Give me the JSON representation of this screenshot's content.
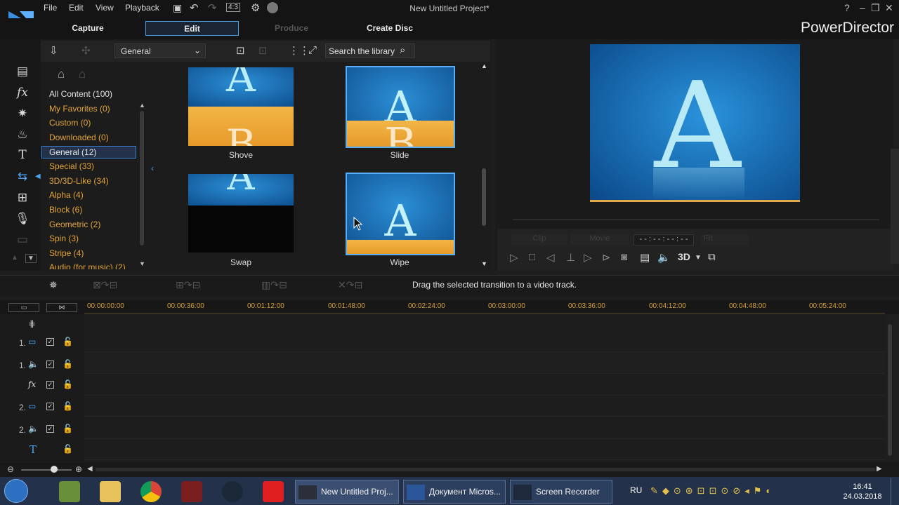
{
  "window": {
    "title": "New Untitled Project*",
    "brand": "PowerDirector"
  },
  "menu": [
    "File",
    "Edit",
    "View",
    "Playback"
  ],
  "modes": [
    "Capture",
    "Edit",
    "Produce",
    "Create Disc"
  ],
  "library": {
    "category_selected": "General",
    "search_placeholder": "Search the library",
    "categories": [
      "All Content (100)",
      "My Favorites  (0)",
      "Custom  (0)",
      "Downloaded  (0)",
      "General  (12)",
      "Special  (33)",
      "3D/3D-Like  (34)",
      "Alpha  (4)",
      "Block  (6)",
      "Geometric  (2)",
      "Spin  (3)",
      "Stripe  (4)",
      "Audio (for music)  (2)"
    ],
    "transitions": [
      "Shove",
      "Slide",
      "Swap",
      "Wipe"
    ]
  },
  "preview": {
    "mode_clip": "Clip",
    "mode_movie": "Movie",
    "timecode": "- - : - - : - - : - -",
    "fit": "Fit",
    "stereo": "3D"
  },
  "hint": "Drag the selected transition to a video track.",
  "ruler": [
    "00:00:00:00",
    "00:00:36:00",
    "00:01:12:00",
    "00:01:48:00",
    "00:02:24:00",
    "00:03:00:00",
    "00:03:36:00",
    "00:04:12:00",
    "00:04:48:00",
    "00:05:24:00"
  ],
  "tracks": [
    "1.",
    "1.",
    "",
    "2.",
    "2.",
    ""
  ],
  "taskbar": {
    "apps": [
      "New Untitled Proj...",
      "Документ Micros...",
      "Screen Recorder"
    ],
    "lang": "RU",
    "time": "16:41",
    "date": "24.03.2018"
  },
  "colors": {
    "accent": "#4e9fe6",
    "category": "#e3a53a",
    "ruler": "#d6a13b",
    "taskbar": "#23324a"
  }
}
